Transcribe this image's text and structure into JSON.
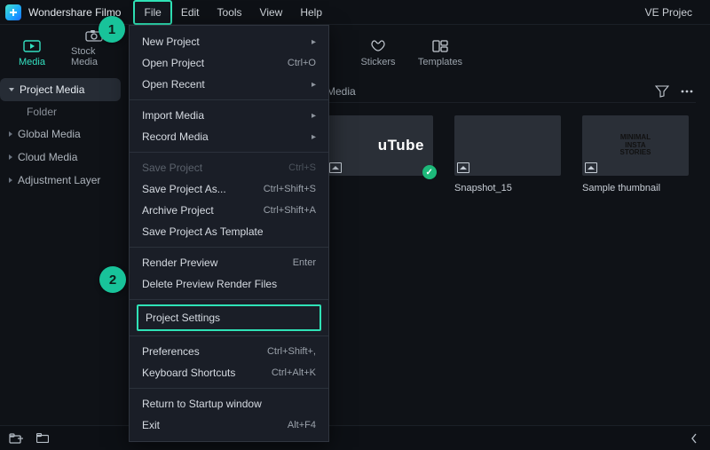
{
  "app": {
    "title": "Wondershare Filmo",
    "project_badge": "VE Projec"
  },
  "menubar": {
    "file": "File",
    "edit": "Edit",
    "tools": "Tools",
    "view": "View",
    "help": "Help"
  },
  "tabs": {
    "media": "Media",
    "stock": "Stock Media",
    "stickers": "Stickers",
    "templates": "Templates"
  },
  "sidebar": {
    "project": "Project Media",
    "folder": "Folder",
    "global": "Global Media",
    "cloud": "Cloud Media",
    "adjust": "Adjustment Layer"
  },
  "content": {
    "crumb": "Media",
    "thumbs": [
      {
        "label": "",
        "yt_text": "uTube"
      },
      {
        "label": "Snapshot_15"
      },
      {
        "label": "Sample thumbnail",
        "insta_text": "MINIMAL\nINSTA\nSTORIES"
      }
    ]
  },
  "dropdown": {
    "new_project": "New Project",
    "open_project": "Open Project",
    "open_project_sc": "Ctrl+O",
    "open_recent": "Open Recent",
    "import_media": "Import Media",
    "record_media": "Record Media",
    "save_project": "Save Project",
    "save_project_sc": "Ctrl+S",
    "save_as": "Save Project As...",
    "save_as_sc": "Ctrl+Shift+S",
    "archive": "Archive Project",
    "archive_sc": "Ctrl+Shift+A",
    "save_tpl": "Save Project As Template",
    "render_preview": "Render Preview",
    "render_preview_sc": "Enter",
    "delete_render": "Delete Preview Render Files",
    "project_settings": "Project Settings",
    "preferences": "Preferences",
    "preferences_sc": "Ctrl+Shift+,",
    "shortcuts": "Keyboard Shortcuts",
    "shortcuts_sc": "Ctrl+Alt+K",
    "startup": "Return to Startup window",
    "exit": "Exit",
    "exit_sc": "Alt+F4"
  },
  "callouts": {
    "one": "1",
    "two": "2"
  }
}
